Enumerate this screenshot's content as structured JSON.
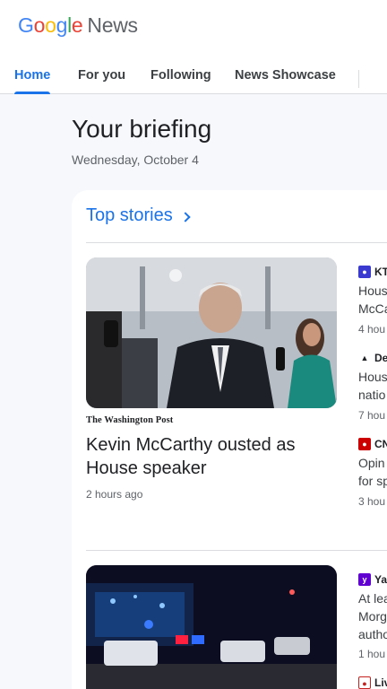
{
  "app": {
    "logo_google": [
      "G",
      "o",
      "o",
      "g",
      "l",
      "e"
    ],
    "logo_news": "News"
  },
  "tabs": [
    {
      "label": "Home",
      "active": true
    },
    {
      "label": "For you",
      "active": false
    },
    {
      "label": "Following",
      "active": false
    },
    {
      "label": "News Showcase",
      "active": false
    }
  ],
  "briefing": {
    "title": "Your briefing",
    "date": "Wednesday, October 4"
  },
  "top_stories": {
    "label": "Top stories",
    "icon": "chevron-right-icon",
    "lead": {
      "publisher": "The Washington Post",
      "headline": "Kevin McCarthy ousted as House speaker",
      "time": "2 hours ago"
    },
    "side": [
      {
        "source": "KT",
        "icon_color": "#3a3ad1",
        "headline_lines": [
          "Hous",
          "McCa"
        ],
        "time": "4 hou"
      },
      {
        "source": "De",
        "icon_color": "#202124",
        "headline_lines": [
          "Hous",
          "natio"
        ],
        "time": "7 hou"
      },
      {
        "source": "CN",
        "icon_color": "#cc0000",
        "headline_lines": [
          "Opin",
          "for sp"
        ],
        "time": "3 hou"
      },
      {
        "source": "Ya",
        "icon_color": "#6001d2",
        "headline_lines": [
          "At lea",
          "Morg",
          "autho"
        ],
        "time": "1 hou"
      },
      {
        "source": "Liv",
        "icon_color": "#c5221f",
        "headline_lines": [],
        "time": ""
      }
    ]
  },
  "colors": {
    "accent": "#1a73e8",
    "background": "#f6f8fc"
  }
}
